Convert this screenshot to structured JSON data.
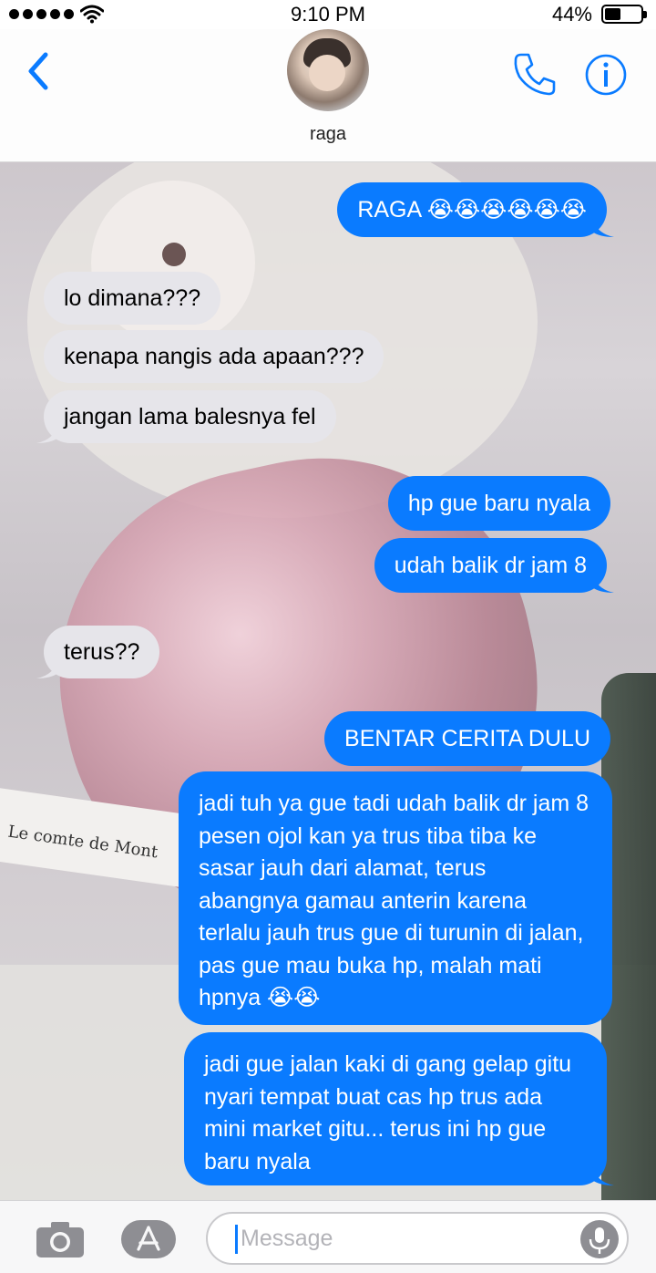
{
  "status_bar": {
    "time": "9:10 PM",
    "battery_percent": "44%",
    "battery_level": 0.44,
    "signal_dots": 5,
    "icons": [
      "signal-dots-icon",
      "wifi-icon",
      "battery-icon"
    ]
  },
  "header": {
    "contact_name": "raga",
    "icons": [
      "chevron-left-icon",
      "avatar",
      "phone-icon",
      "info-icon"
    ]
  },
  "messages": [
    {
      "side": "out",
      "text": "RAGA 😭😭😭😭😭😭"
    },
    {
      "side": "in",
      "text": "lo dimana???"
    },
    {
      "side": "in",
      "text": "kenapa nangis ada apaan???"
    },
    {
      "side": "in",
      "text": "jangan lama balesnya fel"
    },
    {
      "side": "out",
      "text": "hp gue baru nyala"
    },
    {
      "side": "out",
      "text": "udah balik dr jam 8"
    },
    {
      "side": "in",
      "text": "terus??"
    },
    {
      "side": "out",
      "text": "BENTAR CERITA DULU"
    },
    {
      "side": "out",
      "text": "jadi tuh ya gue tadi udah balik dr jam 8 pesen ojol kan ya trus tiba tiba ke sasar jauh dari alamat, terus abangnya gamau anterin karena terlalu jauh trus gue di turunin di jalan, pas gue mau buka hp, malah mati hpnya 😭😭"
    },
    {
      "side": "out",
      "text": "jadi gue jalan kaki di gang gelap gitu nyari tempat buat cas hp trus ada mini market gitu... terus ini hp gue baru nyala"
    }
  ],
  "background": {
    "book_text": "Le comte de Mont"
  },
  "input_bar": {
    "placeholder": "Message",
    "icons": [
      "camera-icon",
      "app-store-icon",
      "microphone-icon"
    ]
  },
  "colors": {
    "accent": "#0a7bff",
    "incoming_bubble": "#e6e5ea",
    "outgoing_bubble": "#0a7bff"
  }
}
